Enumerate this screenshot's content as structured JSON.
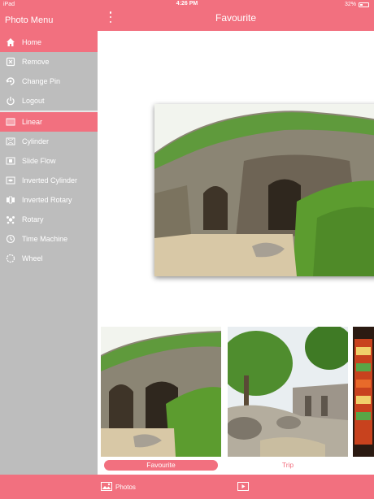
{
  "status_bar": {
    "device": "iPad",
    "time": "4:26 PM",
    "battery": "32%"
  },
  "sidebar": {
    "title": "Photo Menu",
    "items": [
      {
        "label": "Home",
        "icon": "home-icon",
        "active": true
      },
      {
        "label": "Remove",
        "icon": "remove-icon",
        "active": false
      },
      {
        "label": "Change Pin",
        "icon": "pin-icon",
        "active": false
      },
      {
        "label": "Logout",
        "icon": "power-icon",
        "active": false
      },
      {
        "label": "Linear",
        "icon": "linear-icon",
        "active": true
      },
      {
        "label": "Cylinder",
        "icon": "cylinder-icon",
        "active": false
      },
      {
        "label": "Slide Flow",
        "icon": "slide-flow-icon",
        "active": false
      },
      {
        "label": "Inverted Cylinder",
        "icon": "inverted-cylinder-icon",
        "active": false
      },
      {
        "label": "Inverted Rotary",
        "icon": "inverted-rotary-icon",
        "active": false
      },
      {
        "label": "Rotary",
        "icon": "rotary-icon",
        "active": false
      },
      {
        "label": "Time Machine",
        "icon": "time-machine-icon",
        "active": false
      },
      {
        "label": "Wheel",
        "icon": "wheel-icon",
        "active": false
      }
    ]
  },
  "navbar": {
    "title": "Favourite",
    "menu_icon": "more-vertical-icon"
  },
  "albums": [
    {
      "label": "Favourite",
      "selected": true
    },
    {
      "label": "Trip",
      "selected": false
    },
    {
      "label": "",
      "selected": false
    }
  ],
  "tabbar": {
    "photos_label": "Photos",
    "photos_icon": "photos-icon",
    "slideshow_icon": "slideshow-icon"
  },
  "colors": {
    "accent": "#f2707f",
    "sidebar_bg": "#bdbdbd",
    "main_bg": "#ffffff"
  }
}
